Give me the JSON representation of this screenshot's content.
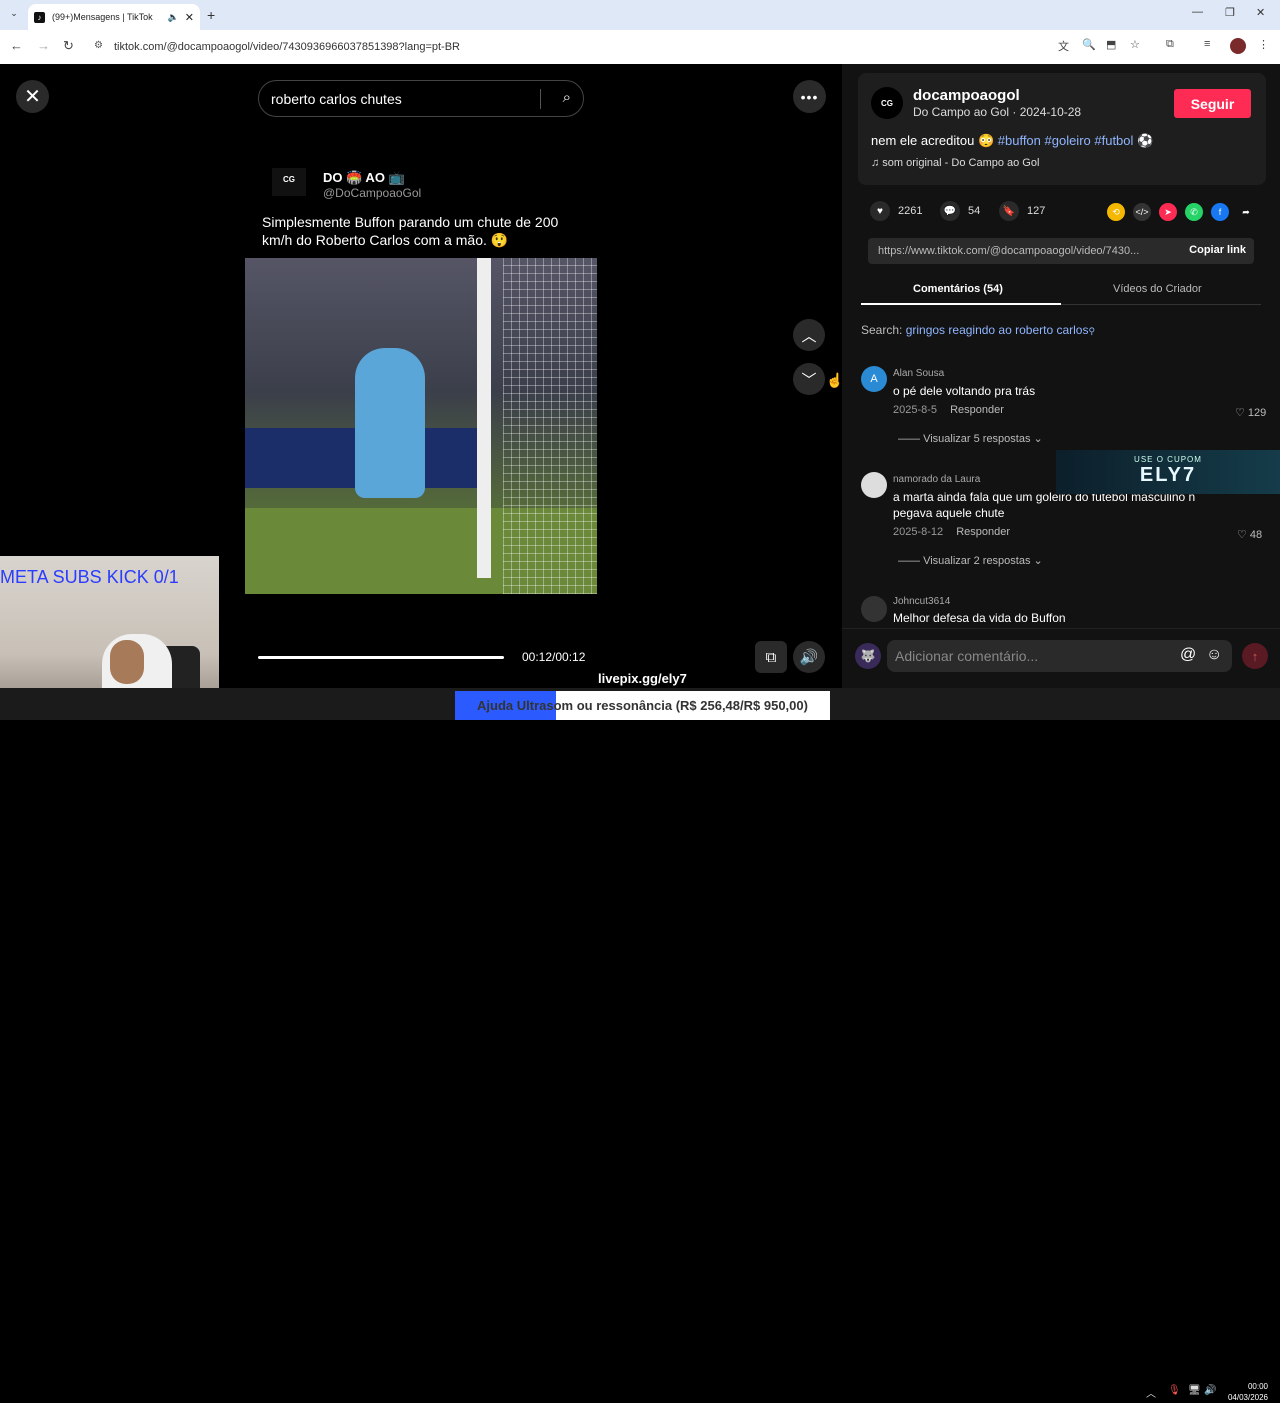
{
  "browser": {
    "tab_title": "(99+)Mensagens | TikTok",
    "url": "tiktok.com/@docampoaogol/video/7430936966037851398?lang=pt-BR"
  },
  "video": {
    "search_text": "roberto carlos chutes",
    "post_name": "DO 🏟️ AO 📺",
    "post_handle": "@DoCampoaoGol",
    "post_logo": "CG",
    "post_text": "Simplesmente Buffon parando um chute de 200 km/h do Roberto Carlos com a mão. 😲",
    "time": "00:12/00:12",
    "progress": 1.0
  },
  "author": {
    "avatar": "CG",
    "name": "docampoaogol",
    "subtitle": "Do Campo ao Gol · 2024-10-28",
    "follow": "Seguir"
  },
  "caption": {
    "text": "nem ele acreditou 😳 ",
    "tags": "#buffon #goleiro #futbol ⚽",
    "music": "♫  som original - Do Campo ao Gol"
  },
  "stats": {
    "likes": "2261",
    "comments": "54",
    "saves": "127"
  },
  "link": {
    "url": "https://www.tiktok.com/@docampoaogol/video/7430...",
    "copy": "Copiar link"
  },
  "tabs": {
    "comments": "Comentários (54)",
    "creator_videos": "Vídeos do Criador"
  },
  "search_suggest": {
    "label": "Search: ",
    "query": "gringos reagindo ao roberto carlos"
  },
  "comments": [
    {
      "avatar": "A",
      "user": "Alan Sousa",
      "text": "o pé dele voltando pra trás",
      "date": "2025-8-5",
      "reply": "Responder",
      "likes": "129",
      "replies": "Visualizar 5 respostas"
    },
    {
      "avatar": "",
      "user": "namorado da Laura",
      "text": "a marta ainda fala que um goleiro do futebol masculino n pegava aquele chute",
      "date": "2025-8-12",
      "reply": "Responder",
      "likes": "48",
      "replies": "Visualizar 2 respostas"
    },
    {
      "avatar": "",
      "user": "Johncut3614",
      "text": "Melhor defesa da vida do Buffon"
    }
  ],
  "promo": {
    "small": "USE O CUPOM",
    "big": "ELY7"
  },
  "comment_input": {
    "placeholder": "Adicionar comentário..."
  },
  "overlay": {
    "meta_subs": "META SUBS KICK 0/1",
    "livepix": "livepix.gg/ely7"
  },
  "goal": {
    "text": "Ajuda Ultrasom ou ressonância (R$ 256,48/R$ 950,00)",
    "progress": 0.27
  },
  "clock": {
    "time": "00:00",
    "date": "04/03/2026"
  },
  "colors": {
    "follow": "#fe2c55",
    "hashtag": "#8fb5ff",
    "goal_fill": "#2b5bff"
  }
}
